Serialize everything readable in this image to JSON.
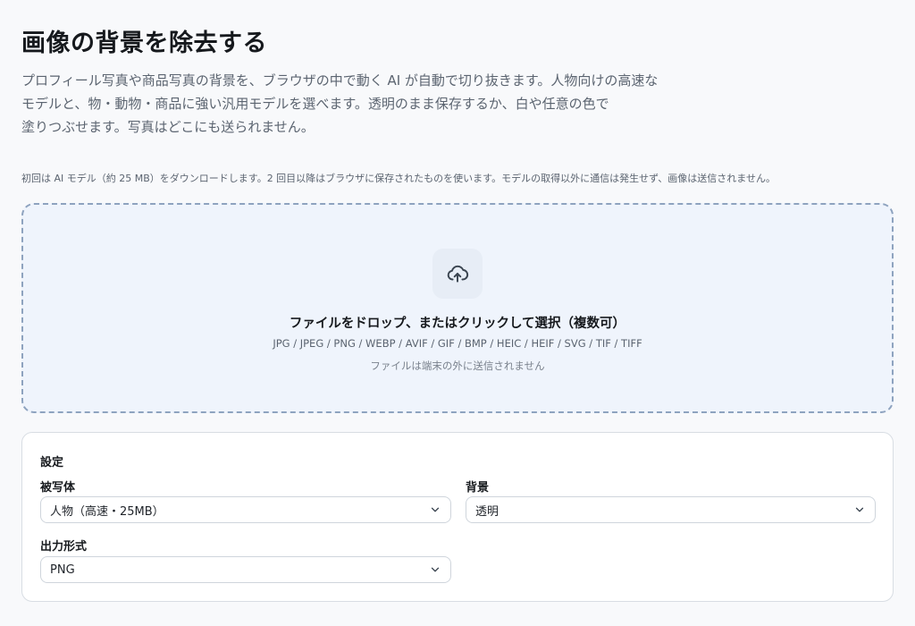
{
  "header": {
    "title": "画像の背景を除去する",
    "description_line1": "プロフィール写真や商品写真の背景を、ブラウザの中で動く AI が自動で切り抜きます。人物向けの高速な",
    "description_line2": "モデルと、物・動物・商品に強い汎用モデルを選べます。透明のまま保存するか、白や任意の色で",
    "description_line3": "塗りつぶせます。写真はどこにも送られません。"
  },
  "notice": "初回は AI モデル（約 25 MB）をダウンロードします。2 回目以降はブラウザに保存されたものを使います。モデルの取得以外に通信は発生せず、画像は送信されません。",
  "dropzone": {
    "icon": "cloud-upload-icon",
    "title": "ファイルをドロップ、またはクリックして選択（複数可）",
    "formats": "JPG / JPEG / PNG / WEBP / AVIF / GIF / BMP / HEIC / HEIF / SVG / TIF / TIFF",
    "hint": "ファイルは端末の外に送信されません"
  },
  "settings": {
    "title": "設定",
    "subject": {
      "label": "被写体",
      "value": "人物（高速・25MB）"
    },
    "background": {
      "label": "背景",
      "value": "透明"
    },
    "output": {
      "label": "出力形式",
      "value": "PNG"
    }
  }
}
